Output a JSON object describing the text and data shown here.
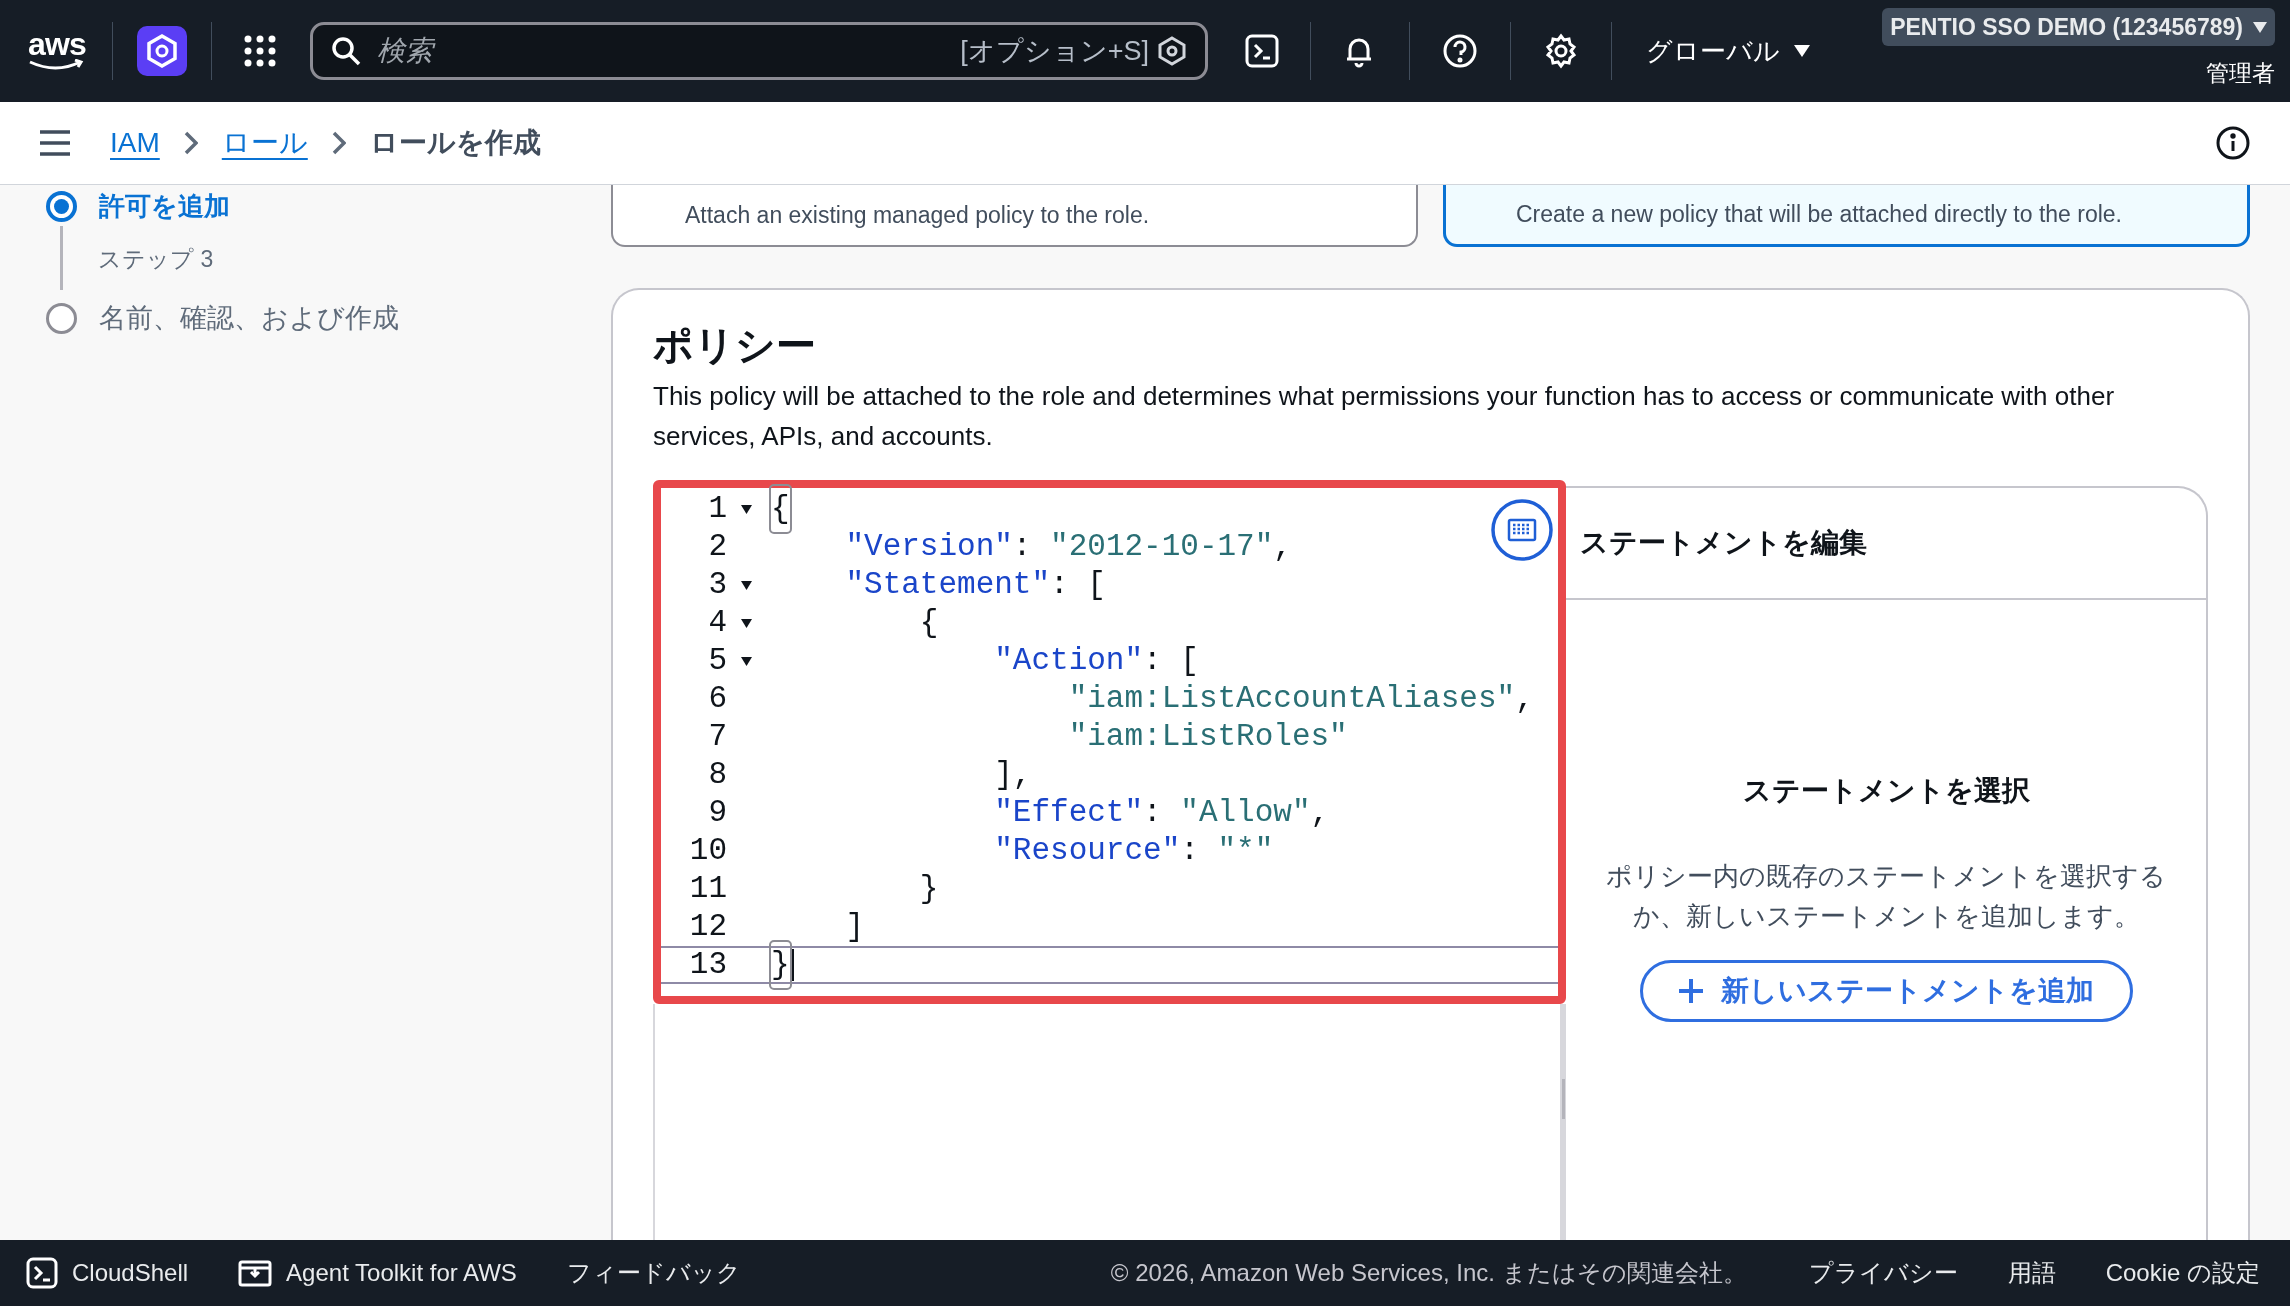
{
  "top_nav": {
    "logo": "aws",
    "search": {
      "placeholder": "検索",
      "shortcut": "[オプション+S]"
    },
    "region": "グローバル",
    "account": "PENTIO SSO DEMO (123456789)",
    "role": "管理者"
  },
  "breadcrumbs": [
    {
      "label": "IAM",
      "link": true
    },
    {
      "label": "ロール",
      "link": true
    },
    {
      "label": "ロールを作成",
      "link": false
    }
  ],
  "steps": [
    {
      "title": "許可を追加",
      "selected": true
    },
    {
      "step_label": "ステップ 3",
      "title": "名前、確認、および作成",
      "selected": false
    }
  ],
  "option_cards": [
    {
      "description": "Attach an existing managed policy to the role.",
      "selected": false
    },
    {
      "description": "Create a new policy that will be attached directly to the role.",
      "selected": true
    }
  ],
  "policy": {
    "title": "ポリシー",
    "description": "This policy will be attached to the role and determines what permissions your function has to access or communicate with other services, APIs, and accounts.",
    "editor": {
      "lines": [
        {
          "number": "1",
          "foldable": true,
          "active": false,
          "segments": [
            {
              "kind": "punct",
              "text": "{",
              "matched": true
            }
          ]
        },
        {
          "number": "2",
          "foldable": false,
          "active": false,
          "segments": [
            {
              "kind": "key",
              "text": "    \"Version\""
            },
            {
              "kind": "punct",
              "text": ": "
            },
            {
              "kind": "string",
              "text": "\"2012-10-17\""
            },
            {
              "kind": "punct",
              "text": ","
            }
          ]
        },
        {
          "number": "3",
          "foldable": true,
          "active": false,
          "segments": [
            {
              "kind": "key",
              "text": "    \"Statement\""
            },
            {
              "kind": "punct",
              "text": ": ["
            }
          ]
        },
        {
          "number": "4",
          "foldable": true,
          "active": false,
          "segments": [
            {
              "kind": "punct",
              "text": "        {"
            }
          ]
        },
        {
          "number": "5",
          "foldable": true,
          "active": false,
          "segments": [
            {
              "kind": "key",
              "text": "            \"Action\""
            },
            {
              "kind": "punct",
              "text": ": ["
            }
          ]
        },
        {
          "number": "6",
          "foldable": false,
          "active": false,
          "segments": [
            {
              "kind": "string",
              "text": "                \"iam:ListAccountAliases\""
            },
            {
              "kind": "punct",
              "text": ","
            }
          ]
        },
        {
          "number": "7",
          "foldable": false,
          "active": false,
          "segments": [
            {
              "kind": "string",
              "text": "                \"iam:ListRoles\""
            }
          ]
        },
        {
          "number": "8",
          "foldable": false,
          "active": false,
          "segments": [
            {
              "kind": "punct",
              "text": "            ],"
            }
          ]
        },
        {
          "number": "9",
          "foldable": false,
          "active": false,
          "segments": [
            {
              "kind": "key",
              "text": "            \"Effect\""
            },
            {
              "kind": "punct",
              "text": ": "
            },
            {
              "kind": "string",
              "text": "\"Allow\""
            },
            {
              "kind": "punct",
              "text": ","
            }
          ]
        },
        {
          "number": "10",
          "foldable": false,
          "active": false,
          "segments": [
            {
              "kind": "key",
              "text": "            \"Resource\""
            },
            {
              "kind": "punct",
              "text": ": "
            },
            {
              "kind": "string",
              "text": "\"*\""
            }
          ]
        },
        {
          "number": "11",
          "foldable": false,
          "active": false,
          "segments": [
            {
              "kind": "punct",
              "text": "        }"
            }
          ]
        },
        {
          "number": "12",
          "foldable": false,
          "active": false,
          "segments": [
            {
              "kind": "punct",
              "text": "    ]"
            }
          ]
        },
        {
          "number": "13",
          "foldable": false,
          "active": true,
          "segments": [
            {
              "kind": "punct",
              "text": "}",
              "matched": true
            }
          ]
        }
      ]
    },
    "statement_panel": {
      "title": "ステートメントを編集",
      "empty_title": "ステートメントを選択",
      "empty_description": "ポリシー内の既存のステートメントを選択するか、新しいステートメントを追加します。",
      "add_button": "新しいステートメントを追加"
    }
  },
  "footer": {
    "cloudshell": "CloudShell",
    "agent_toolkit": "Agent Toolkit for AWS",
    "feedback": "フィードバック",
    "copyright": "© 2026, Amazon Web Services, Inc. またはその関連会社。",
    "links": [
      "プライバシー",
      "用語",
      "Cookie の設定"
    ]
  }
}
